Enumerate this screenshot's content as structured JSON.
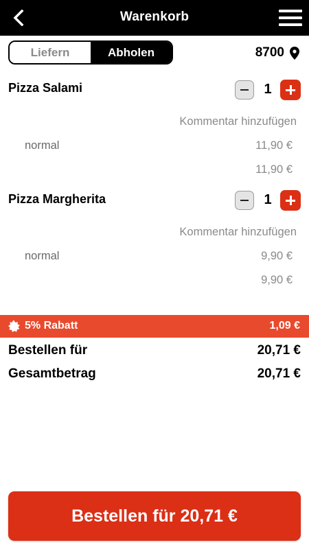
{
  "header": {
    "title": "Warenkorb",
    "back_icon": "chevron-left-icon",
    "menu_icon": "hamburger-menu-icon"
  },
  "mode_toggle": {
    "options": [
      {
        "label": "Liefern",
        "selected": false
      },
      {
        "label": "Abholen",
        "selected": true
      }
    ]
  },
  "location": {
    "zip": "8700",
    "icon": "map-pin-icon"
  },
  "cart": {
    "items": [
      {
        "name": "Pizza Salami",
        "quantity": "1",
        "comment_label": "Kommentar hinzufügen",
        "variant": "normal",
        "variant_price": "11,90 €",
        "total": "11,90 €"
      },
      {
        "name": "Pizza Margherita",
        "quantity": "1",
        "comment_label": "Kommentar hinzufügen",
        "variant": "normal",
        "variant_price": "9,90 €",
        "total": "9,90 €"
      }
    ]
  },
  "discount": {
    "label": "5% Rabatt",
    "value": "1,09 €",
    "icon": "discount-badge-icon",
    "color": "#e84a2d"
  },
  "summary": {
    "order_for_label": "Bestellen für",
    "order_for_value": "20,71 €",
    "total_label": "Gesamtbetrag",
    "total_value": "20,71 €"
  },
  "order_button": {
    "label": "Bestellen für 20,71 €",
    "color": "#db2f16"
  },
  "colors": {
    "accent": "#dc3015",
    "header_bg": "#000000",
    "muted_text": "#8a8a8a"
  }
}
